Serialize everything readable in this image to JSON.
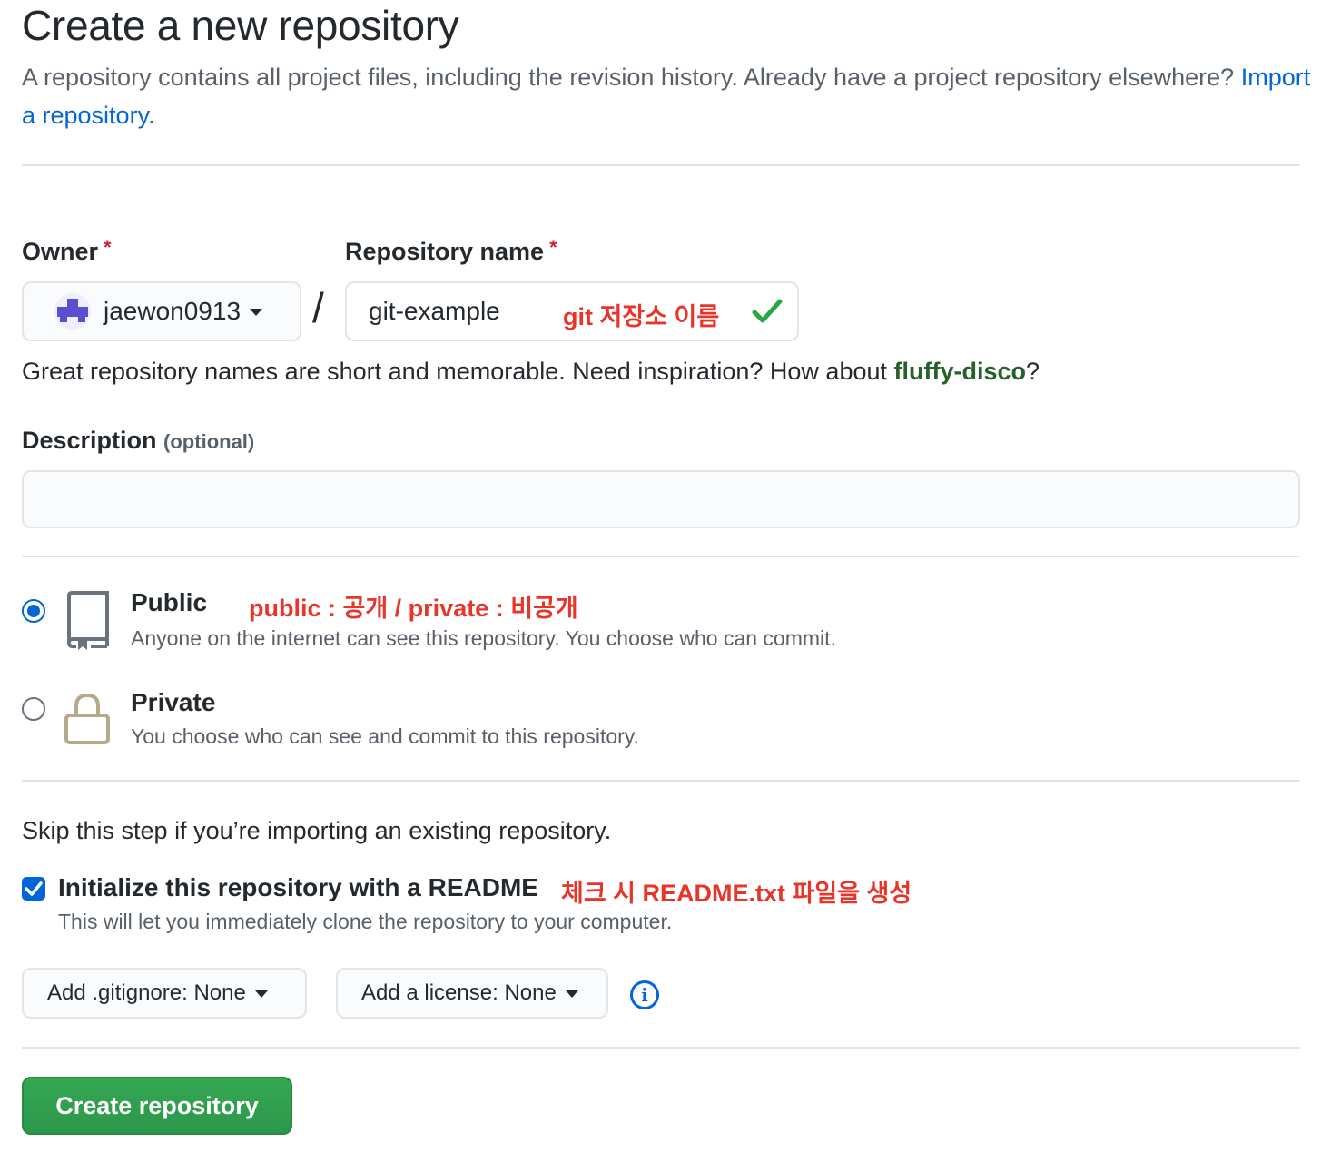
{
  "header": {
    "title": "Create a new repository",
    "subtitle_text": "A repository contains all project files, including the revision history. Already have a project repository elsewhere?",
    "import_link": "Import a repository."
  },
  "owner": {
    "label": "Owner",
    "required_mark": "*",
    "value": "jaewon0913"
  },
  "repo_name": {
    "label": "Repository name",
    "required_mark": "*",
    "value": "git-example",
    "annotation": "git 저장소 이름"
  },
  "hint": {
    "prefix": "Great repository names are short and memorable. Need inspiration? How about ",
    "suggestion": "fluffy-disco",
    "suffix": "?"
  },
  "description": {
    "label": "Description",
    "optional": "(optional)",
    "value": ""
  },
  "visibility": {
    "annotation": "public : 공개 / private : 비공개",
    "public": {
      "title": "Public",
      "desc": "Anyone on the internet can see this repository. You choose who can commit.",
      "selected": true
    },
    "private": {
      "title": "Private",
      "desc": "You choose who can see and commit to this repository.",
      "selected": false
    }
  },
  "init": {
    "skip_text": "Skip this step if you’re importing an existing repository.",
    "readme_label": "Initialize this repository with a README",
    "readme_checked": true,
    "readme_annotation": "체크 시 README.txt 파일을 생성",
    "readme_desc": "This will let you immediately clone the repository to your computer."
  },
  "dropdowns": {
    "gitignore_prefix": "Add .gitignore:",
    "gitignore_value": "None",
    "license_prefix": "Add a license:",
    "license_value": "None"
  },
  "submit": {
    "label": "Create repository"
  },
  "colors": {
    "link": "#0366d6",
    "annotation": "#e8352a",
    "button": "#2ea44f",
    "suggestion": "#28602c"
  }
}
